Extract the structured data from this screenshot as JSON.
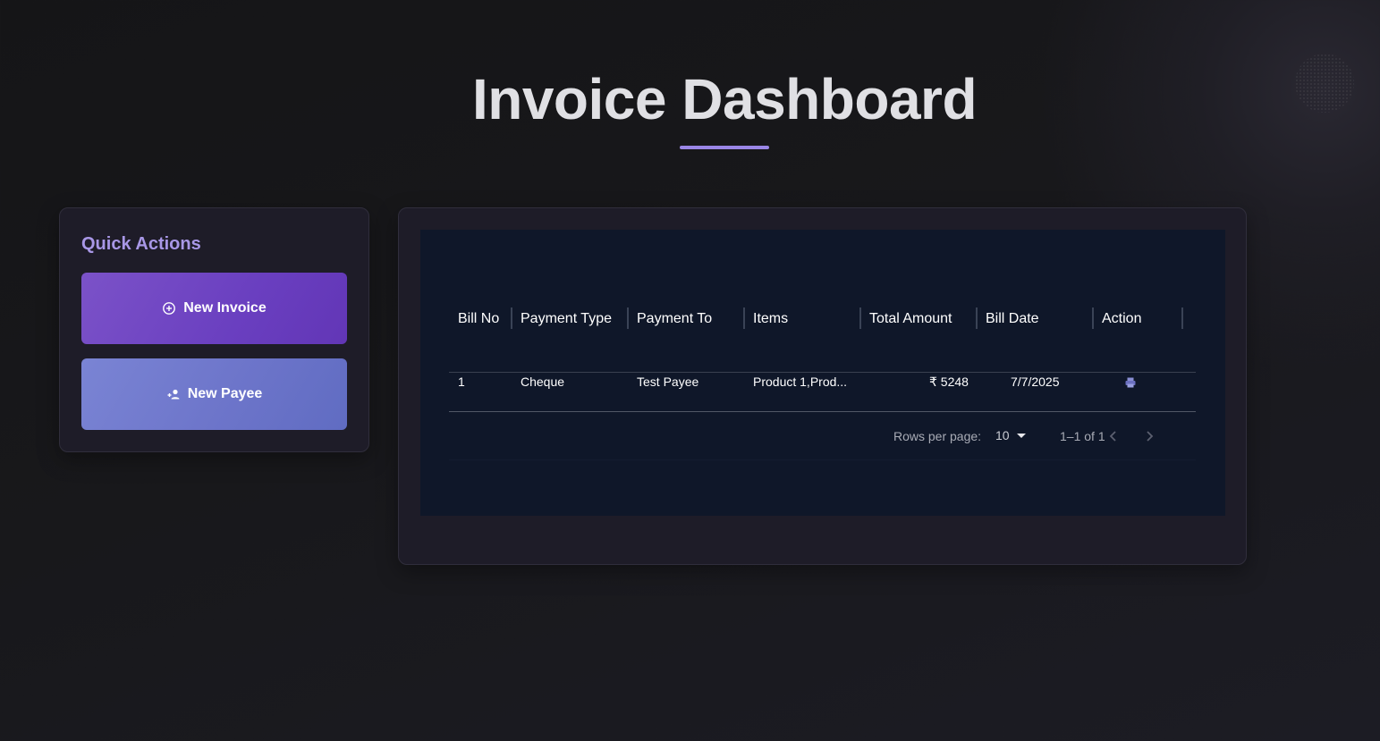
{
  "page": {
    "title": "Invoice Dashboard"
  },
  "quick_actions": {
    "title": "Quick Actions",
    "new_invoice_label": "New Invoice",
    "new_payee_label": "New Payee"
  },
  "table": {
    "columns": [
      "Bill No",
      "Payment Type",
      "Payment To",
      "Items",
      "Total Amount",
      "Bill Date",
      "Action"
    ],
    "rows": [
      {
        "bill_no": "1",
        "payment_type": "Cheque",
        "payment_to": "Test Payee",
        "items": "Product 1,Prod...",
        "total_amount": "₹ 5248",
        "bill_date": "7/7/2025",
        "action_icon": "print-icon"
      }
    ]
  },
  "pagination": {
    "rows_per_page_label": "Rows per page:",
    "rows_per_page_value": "10",
    "range_text": "1–1 of 1"
  },
  "colors": {
    "accent": "#9a86e6",
    "quick_title": "#a897e6",
    "invoice_button": "#6a3fc0",
    "payee_button": "#6d75ca",
    "table_bg": "#0f1729"
  }
}
